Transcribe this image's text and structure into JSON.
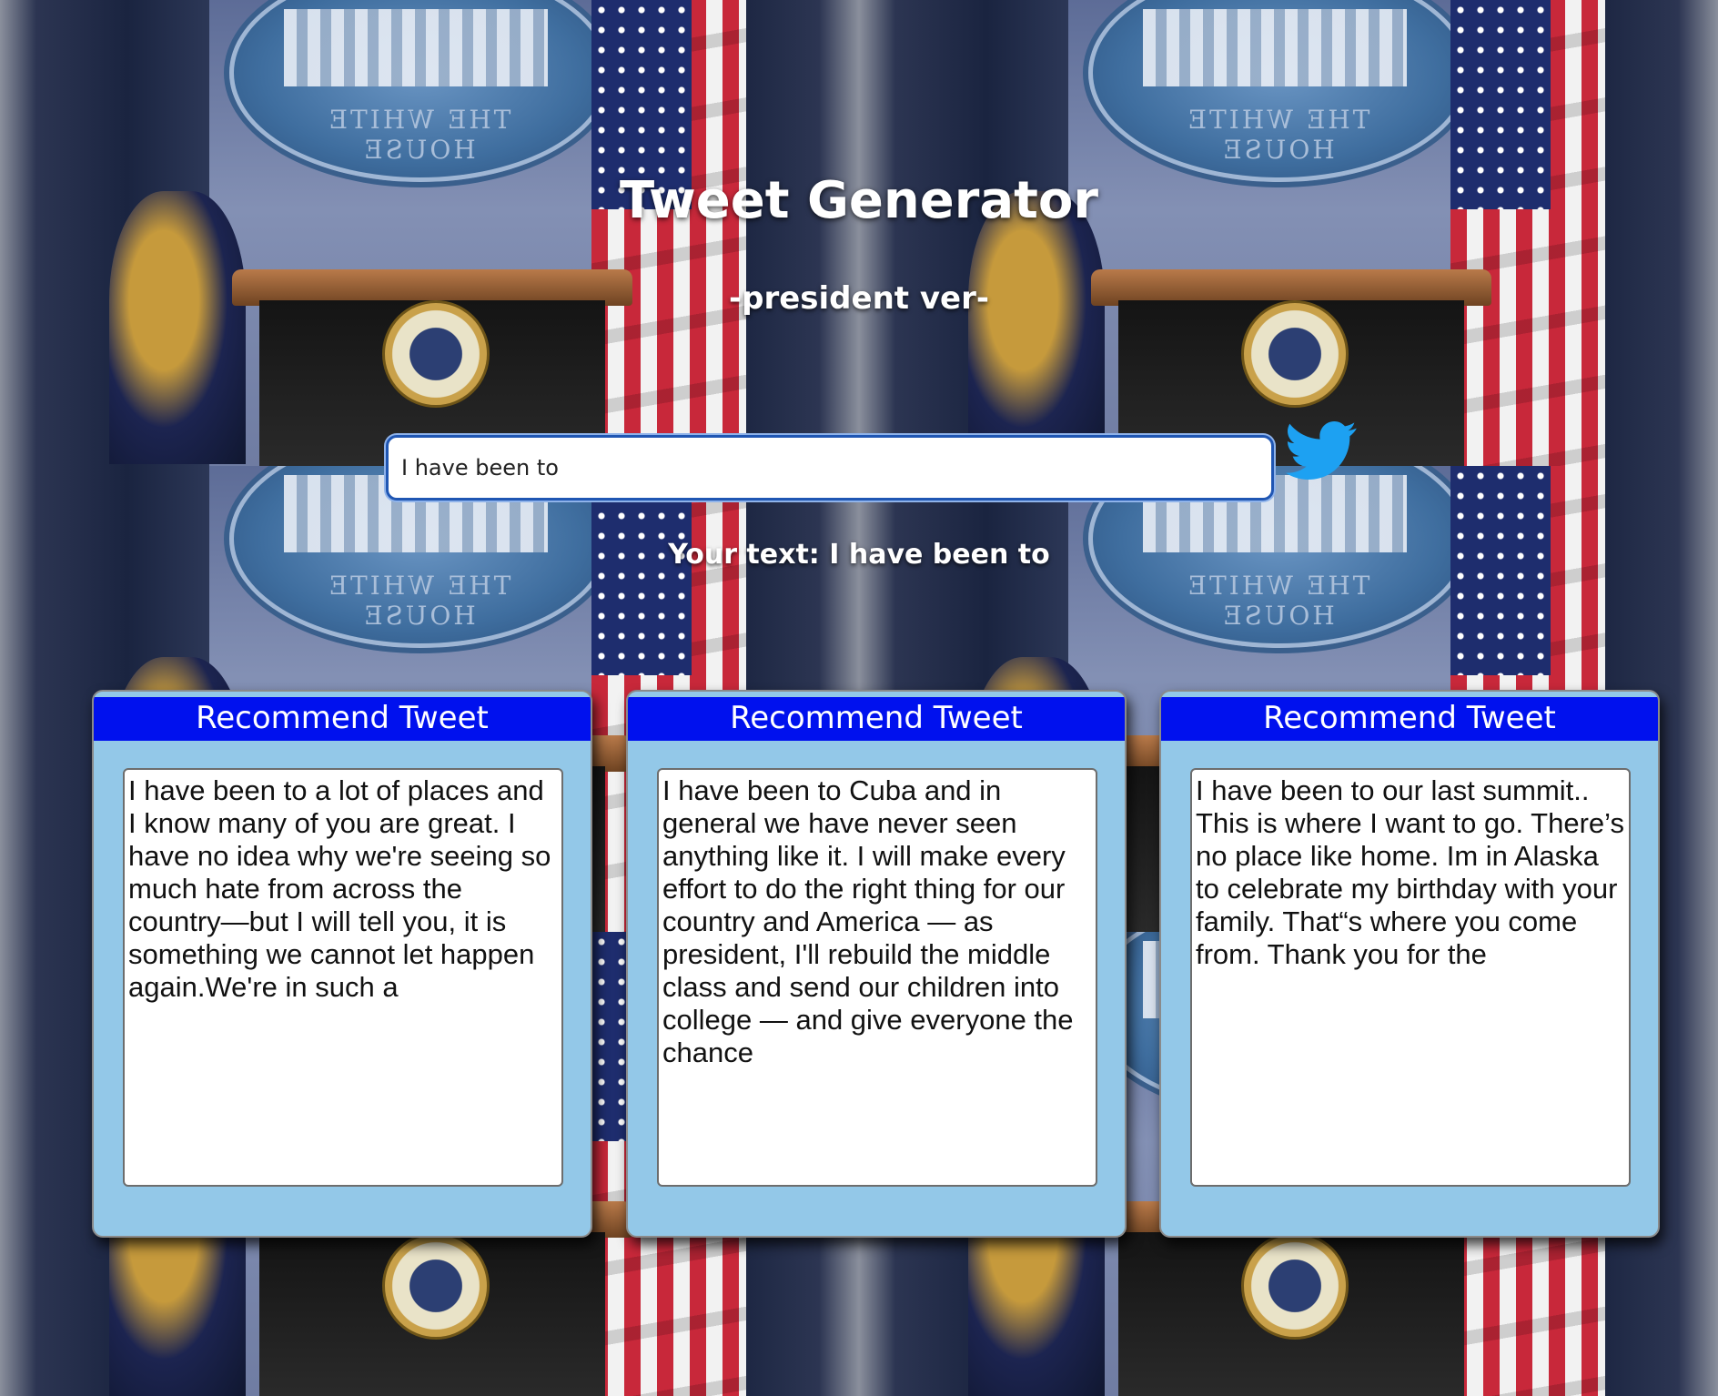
{
  "app": {
    "title": "Tweet Generator",
    "subtitle": "-president ver-"
  },
  "input": {
    "value": "I have been to"
  },
  "echo": {
    "label": "Your text: I have been to"
  },
  "colors": {
    "card_header": "#0011ee",
    "card_background": "#93c8e8",
    "input_border": "#1f56b3",
    "twitter_blue": "#1da1f2"
  },
  "icons": {
    "send": "twitter-bird-icon"
  },
  "cards": [
    {
      "header": "Recommend Tweet",
      "text": "I have been to a lot of places and I know many of you are great. I have no idea why we're seeing so much hate from across the country—but I will tell you, it is something we cannot let happen again.We're in such a"
    },
    {
      "header": "Recommend Tweet",
      "text": "I have been to Cuba and in general we have never seen anything like it. I will make every effort to do the right thing for our country and America — as president, I'll rebuild the middle class and send our children into college — and give everyone the chance"
    },
    {
      "header": "Recommend Tweet",
      "text": "I have been to our last summit.. This is where I want to go. There’s no place like home. Im in Alaska to celebrate my birthday with your family. That“s where you come from. Thank you for the"
    }
  ]
}
